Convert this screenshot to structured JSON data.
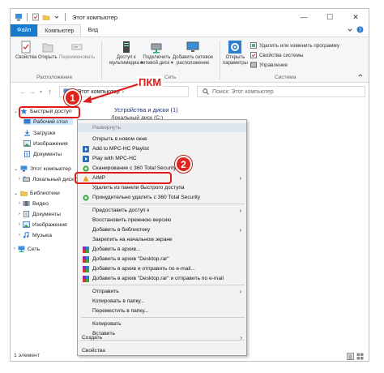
{
  "window": {
    "title": "Этот компьютер",
    "controls": [
      "—",
      "☐",
      "✕"
    ]
  },
  "tabs": [
    {
      "label": "Файл"
    },
    {
      "label": "Компьютер"
    },
    {
      "label": "Вид"
    }
  ],
  "ribbon": {
    "location_group": "Расположение",
    "network_group": "Сеть",
    "system_group": "Система",
    "btn_properties": "Свойства",
    "btn_open": "Открыть",
    "btn_rename": "Переименовать",
    "btn_media": [
      "Доступ к",
      "мультимедиа ▾"
    ],
    "btn_map_drive": [
      "Подключить",
      "сетевой диск ▾"
    ],
    "btn_add_location": [
      "Добавить сетевое",
      "расположение"
    ],
    "btn_open_settings": [
      "Открыть",
      "параметры"
    ],
    "sys_uninstall": "Удалить или изменить программу",
    "sys_properties": "Свойства системы",
    "sys_manage": "Управление"
  },
  "address": {
    "path": "Этот компьютер",
    "search_placeholder": "Поиск: Этот компьютер"
  },
  "nav": {
    "quick_access": "Быстрый доступ",
    "desktop": "Рабочий стол",
    "downloads": "Загрузки",
    "images": "Изображения",
    "documents": "Документы",
    "this_pc": "Этот компьютер",
    "local_disk": "Локальный диск (",
    "libraries": "Библиотеки",
    "video": "Видео",
    "lib_documents": "Документы",
    "lib_images": "Изображения",
    "music": "Музыка",
    "network": "Сеть"
  },
  "main": {
    "devices_header": "Устройства и диски (1)",
    "local_disk": "Локальный диск (C:)"
  },
  "status": {
    "count": "1 элемент"
  },
  "annotation": {
    "pkm": "ПКМ",
    "step1": "1",
    "step2": "2"
  },
  "context_menu": {
    "items": [
      {
        "label": "Развернуть"
      },
      {
        "label": "Открыть в новом окне"
      },
      {
        "label": "Add to MPC-HC Playlist"
      },
      {
        "label": "Play with MPC-HC"
      },
      {
        "label": "Сканирование с 360 Total Security"
      },
      {
        "label": "AIMP"
      },
      {
        "label": "Удалить из панели быстрого доступа"
      },
      {
        "label": "Принудительно удалить с 360 Total Security"
      },
      {
        "label": "Предоставить доступ к"
      },
      {
        "label": "Восстановить прежнюю версию"
      },
      {
        "label": "Добавить в библиотеку"
      },
      {
        "label": "Закрепить на начальном экране"
      },
      {
        "label": "Добавить в архив..."
      },
      {
        "label": "Добавить в архив \"Desktop.rar\""
      },
      {
        "label": "Добавить в архив и отправить по e-mail..."
      },
      {
        "label": "Добавить в архив \"Desktop.rar\" и отправить по e-mail"
      },
      {
        "label": "Отправить"
      },
      {
        "label": "Копировать в папку..."
      },
      {
        "label": "Переместить в папку..."
      },
      {
        "label": "Копировать"
      },
      {
        "label": "Вставить"
      },
      {
        "label": "Создать"
      },
      {
        "label": "Свойства"
      }
    ]
  },
  "colors": {
    "accent": "#1979ca",
    "annotation_red": "#e01b1b",
    "selection": "#cce8ff",
    "menu_bg": "#f2f2f2"
  }
}
